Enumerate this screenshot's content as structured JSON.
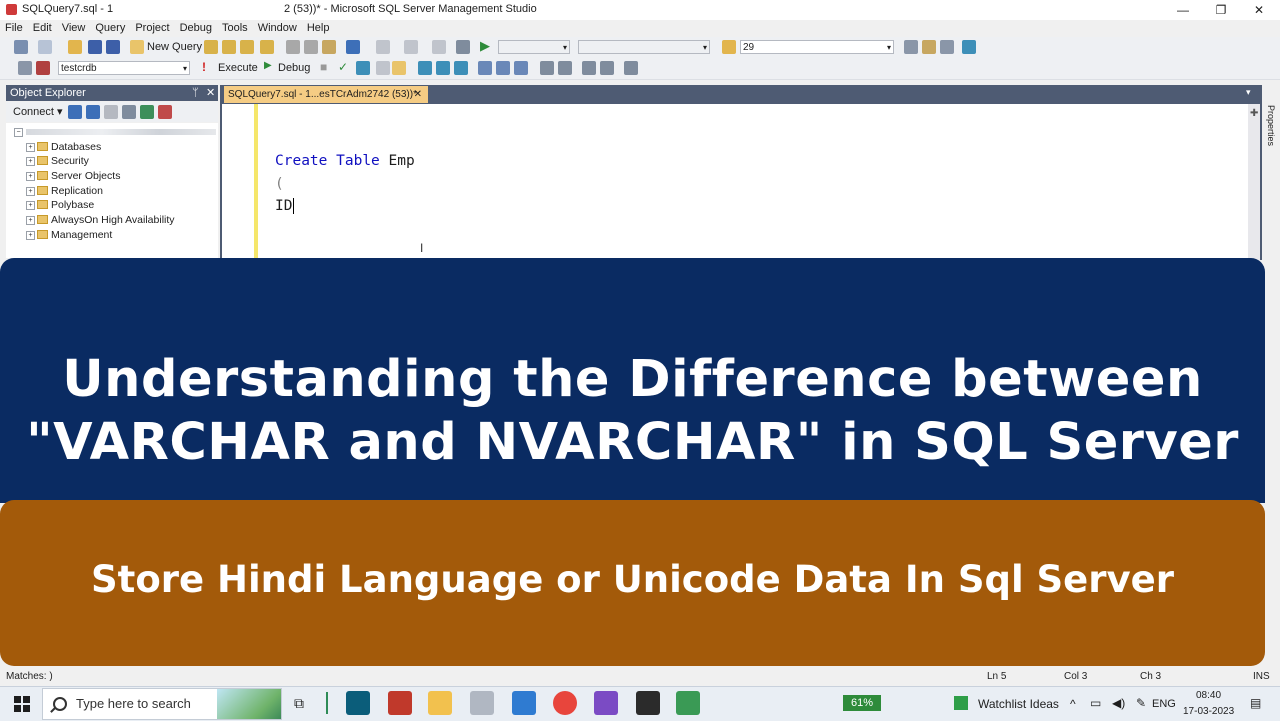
{
  "window": {
    "doc_title": "SQLQuery7.sql - 1",
    "center_title": "2 (53))* - Microsoft SQL Server Management Studio",
    "minimize": "—",
    "maximize": "❐",
    "close": "✕"
  },
  "menu": [
    "File",
    "Edit",
    "View",
    "Query",
    "Project",
    "Debug",
    "Tools",
    "Window",
    "Help"
  ],
  "toolbar1": {
    "new_query": "New Query",
    "combo_value": "29"
  },
  "toolbar2": {
    "database": "testcrdb",
    "execute": "Execute",
    "debug": "Debug"
  },
  "object_explorer": {
    "title": "Object Explorer",
    "connect": "Connect",
    "pin": "ᛘ",
    "close": "✕",
    "tree": [
      "Databases",
      "Security",
      "Server Objects",
      "Replication",
      "Polybase",
      "AlwaysOn High Availability",
      "Management"
    ]
  },
  "editor": {
    "tab_label": "SQLQuery7.sql - 1...esTCrAdm2742 (53))*",
    "tab_close": "✕",
    "lines": [
      {
        "kw1": "Create",
        "kw2": "Table",
        "rest": "Emp"
      },
      {
        "text": "("
      },
      {
        "text": "ID"
      }
    ],
    "properties_label": "Properties"
  },
  "banner": {
    "line1": "Understanding the Difference between",
    "line2": "\"VARCHAR and NVARCHAR\" in SQL Server",
    "subtitle": "Store Hindi Language or Unicode Data In Sql Server",
    "colors": {
      "top": "#0a2b62",
      "bottom": "#a35a0a"
    }
  },
  "statusbar": {
    "matches": "Matches: )",
    "ln": "Ln 5",
    "col": "Col 3",
    "ch": "Ch 3",
    "ins": "INS"
  },
  "taskbar": {
    "search_placeholder": "Type here to search",
    "battery": "61%",
    "watchlist": "Watchlist Ideas",
    "lang": "ENG",
    "time": "08:40",
    "date": "17-03-2023"
  }
}
